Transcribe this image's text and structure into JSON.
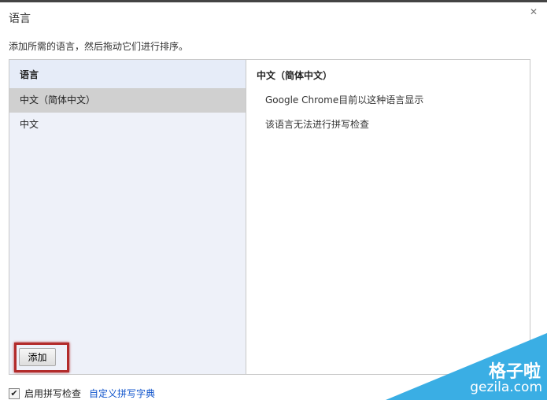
{
  "dialog": {
    "title": "语言",
    "subtitle": "添加所需的语言，然后拖动它们进行排序。"
  },
  "left": {
    "header": "语言",
    "items": [
      {
        "label": "中文（简体中文）",
        "selected": true
      },
      {
        "label": "中文",
        "selected": false
      }
    ],
    "add_button": "添加"
  },
  "right": {
    "header": "中文（简体中文）",
    "lines": [
      "Google Chrome目前以这种语言显示",
      "该语言无法进行拼写检查"
    ]
  },
  "footer": {
    "checkbox_label": "启用拼写检查",
    "checked": true,
    "link": "自定义拼写字典"
  },
  "watermark": {
    "line1": "格子啦",
    "line2": "gezila.com"
  },
  "colors": {
    "highlight": "#b22b2b",
    "watermark": "#3aaee4"
  }
}
